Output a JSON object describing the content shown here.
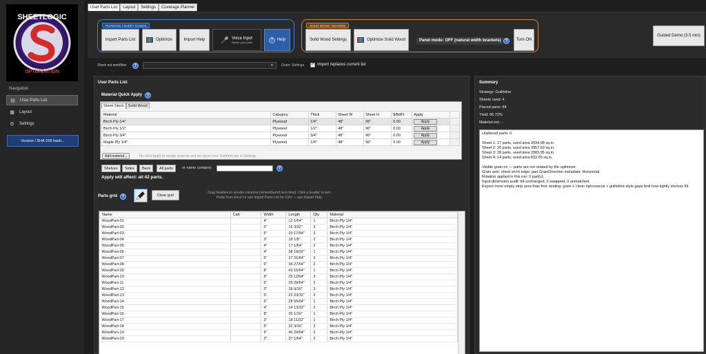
{
  "logo": {
    "text_top": "SHEETLOGIC",
    "text_bottom": "OPTIMIZATION",
    "letter": "S"
  },
  "sidebar": {
    "title": "Navigation",
    "items": [
      {
        "label": "User Parts List",
        "icon": "list-icon",
        "active": true
      },
      {
        "label": "Layout",
        "icon": "layout-icon",
        "active": false
      },
      {
        "label": "Settings",
        "icon": "gear-icon",
        "active": false
      }
    ],
    "version": "Version / SHA-256 hash..."
  },
  "tabs": [
    "User Parts List",
    "Layout",
    "Settings",
    "Coverage Planner"
  ],
  "toolbar": {
    "ply_group": "PLYWOOD / SHEET GOODS",
    "solid_group": "SOLID WOOD / BOARDS",
    "import_parts": "Import Parts List",
    "optimize": "Optimize",
    "import_help": "Import Help",
    "voice_input": "Voice Input",
    "voice_sub": "Speak your parts",
    "help": "Help",
    "solid_settings": "Solid Wood Settings",
    "optimize_solid": "Optimize Solid Wood",
    "panel_mode": "Panel mode: OFF (natural width brackets)",
    "turn_on": "Turn ON",
    "guided_demo": "Guided Demo (3-5 min)"
  },
  "workflow": {
    "label": "Sheet out workflow",
    "select_value": "",
    "grain": "Grain: Settings",
    "import_replaces": "Import replaces current list",
    "import_replaces_checked": true
  },
  "main": {
    "title": "User Parts List",
    "mqa_title": "Material Quick Apply",
    "inner_tabs": [
      "Sheet Stock",
      "Solid Wood"
    ],
    "mat_headers": [
      "Material",
      "Category",
      "Thick",
      "Sheet W",
      "Sheet H",
      "$/BdFt",
      "Apply"
    ],
    "materials": [
      {
        "material": "Birch Ply 1/4\"",
        "category": "Plywood",
        "thick": "1/4\"",
        "w": "48\"",
        "h": "96\"",
        "price": "0.00",
        "apply": "Apply"
      },
      {
        "material": "Birch Ply 1/2\"",
        "category": "Plywood",
        "thick": "1/2\"",
        "w": "48\"",
        "h": "96\"",
        "price": "0.00",
        "apply": "Apply"
      },
      {
        "material": "Birch Ply 3/4\"",
        "category": "Plywood",
        "thick": "3/4\"",
        "w": "48\"",
        "h": "96\"",
        "price": "0.00",
        "apply": "Apply"
      },
      {
        "material": "Maple Ply 1/4\"",
        "category": "Plywood",
        "thick": "1/4\"",
        "w": "48\"",
        "h": "96\"",
        "price": "0.00",
        "apply": "Apply"
      }
    ],
    "add_material": "Add material...",
    "tip": "Tip: click Apply to assign material and set sheet size. Kerf/trim are in Settings.",
    "filters": [
      "Shelves",
      "Sides",
      "Back",
      "All parts"
    ],
    "or_name": "or name contains:",
    "name_value": "",
    "affect": "Apply will affect: all 42 parts.",
    "parts_grid_label": "Parts grid",
    "clear_grid": "Clear grid",
    "grid_tip_1": "Drag headers to reorder columns (remembered next time). Click a header to sort.",
    "grid_tip_2": "Paste from Excel or use Import Parts List for CSV — see Import Help.",
    "parts_headers": [
      "Name",
      "Cab",
      "Width",
      "Length",
      "Qty",
      "Material"
    ],
    "parts": [
      {
        "name": "WoodPart-01",
        "cab": "",
        "width": "4\"",
        "length": "12 1/64\"",
        "qty": "1",
        "material": "Birch Ply 1/4\""
      },
      {
        "name": "WoodPart-02",
        "cab": "",
        "width": "3\"",
        "length": "16 3/32\"",
        "qty": "3",
        "material": "Birch Ply 1/4\""
      },
      {
        "name": "WoodPart-03",
        "cab": "",
        "width": "5\"",
        "length": "33 17/64\"",
        "qty": "3",
        "material": "Birch Ply 1/4\""
      },
      {
        "name": "WoodPart-04",
        "cab": "",
        "width": "3\"",
        "length": "18 1/8\"",
        "qty": "2",
        "material": "Birch Ply 1/4\""
      },
      {
        "name": "WoodPart-05",
        "cab": "",
        "width": "4\"",
        "length": "17 1/64\"",
        "qty": "2",
        "material": "Birch Ply 1/4\""
      },
      {
        "name": "WoodPart-06",
        "cab": "",
        "width": "4\"",
        "length": "38 19/32\"",
        "qty": "1",
        "material": "Birch Ply 1/4\""
      },
      {
        "name": "WoodPart-07",
        "cab": "",
        "width": "5\"",
        "length": "27 31/64\"",
        "qty": "3",
        "material": "Birch Ply 1/4\""
      },
      {
        "name": "WoodPart-08",
        "cab": "",
        "width": "6\"",
        "length": "34 27/64\"",
        "qty": "2",
        "material": "Birch Ply 1/4\""
      },
      {
        "name": "WoodPart-09",
        "cab": "",
        "width": "8\"",
        "length": "43 15/64\"",
        "qty": "1",
        "material": "Birch Ply 1/4\""
      },
      {
        "name": "WoodPart-10",
        "cab": "",
        "width": "8\"",
        "length": "25 11/64\"",
        "qty": "3",
        "material": "Birch Ply 1/4\""
      },
      {
        "name": "WoodPart-11",
        "cab": "",
        "width": "5\"",
        "length": "39 29/64\"",
        "qty": "2",
        "material": "Birch Ply 1/4\""
      },
      {
        "name": "WoodPart-12",
        "cab": "",
        "width": "3\"",
        "length": "28 9/16\"",
        "qty": "3",
        "material": "Birch Ply 1/4\""
      },
      {
        "name": "WoodPart-13",
        "cab": "",
        "width": "5\"",
        "length": "22 23/32\"",
        "qty": "3",
        "material": "Birch Ply 1/4\""
      },
      {
        "name": "WoodPart-14",
        "cab": "",
        "width": "6\"",
        "length": "28 55/64\"",
        "qty": "1",
        "material": "Birch Ply 1/4\""
      },
      {
        "name": "WoodPart-15",
        "cab": "",
        "width": "4\"",
        "length": "14 13/32\"",
        "qty": "2",
        "material": "Birch Ply 1/4\""
      },
      {
        "name": "WoodPart-16",
        "cab": "",
        "width": "8\"",
        "length": "39 1/16\"",
        "qty": "1",
        "material": "Birch Ply 1/4\""
      },
      {
        "name": "WoodPart-17",
        "cab": "",
        "width": "3\"",
        "length": "18 11/32\"",
        "qty": "1",
        "material": "Birch Ply 1/4\""
      },
      {
        "name": "WoodPart-18",
        "cab": "",
        "width": "5\"",
        "length": "32 3/16\"",
        "qty": "3",
        "material": "Birch Ply 1/4\""
      },
      {
        "name": "WoodPart-19",
        "cab": "",
        "width": "6\"",
        "length": "40 29/64\"",
        "qty": "2",
        "material": "Birch Ply 1/4\""
      },
      {
        "name": "WoodPart-20",
        "cab": "",
        "width": "3\"",
        "length": "37 1/64\"",
        "qty": "2",
        "material": "Birch Ply 1/4\""
      }
    ]
  },
  "summary": {
    "title": "Summary",
    "strategy": "Strategy: Guillotine",
    "sheets_used": "Sheets used: 4",
    "placed_parts": "Placed parts: 84",
    "yield": "Yield: 66.72%",
    "material_est": "Material est.: -",
    "details": [
      "Unplaced parts: 0",
      "",
      "Sheet 1: 17 parts, used area 3594.98 sq.in.",
      "Sheet 2: 25 parts, used area 3957.53 sq.in.",
      "Sheet 3: 28 parts, used area 3383.95 sq.in.",
      "Sheet 4: 14 parts, used area 833.65 sq.in.",
      "",
      "Visible grain on — parts are not rotated by the optimizer.",
      "Grain axis: sheet short edge; part GrainDirection metadata: Horizontal.",
      "Rotation applied in this run: 0 part(s).",
      "Input-dimension audit: 84 unchanged, 0 swapped, 0 unmatched.",
      "Expect more empty strip area than free nesting: grain + clean rip/crosscut + guillotine-style gaps limit how tightly shelves fill."
    ]
  }
}
